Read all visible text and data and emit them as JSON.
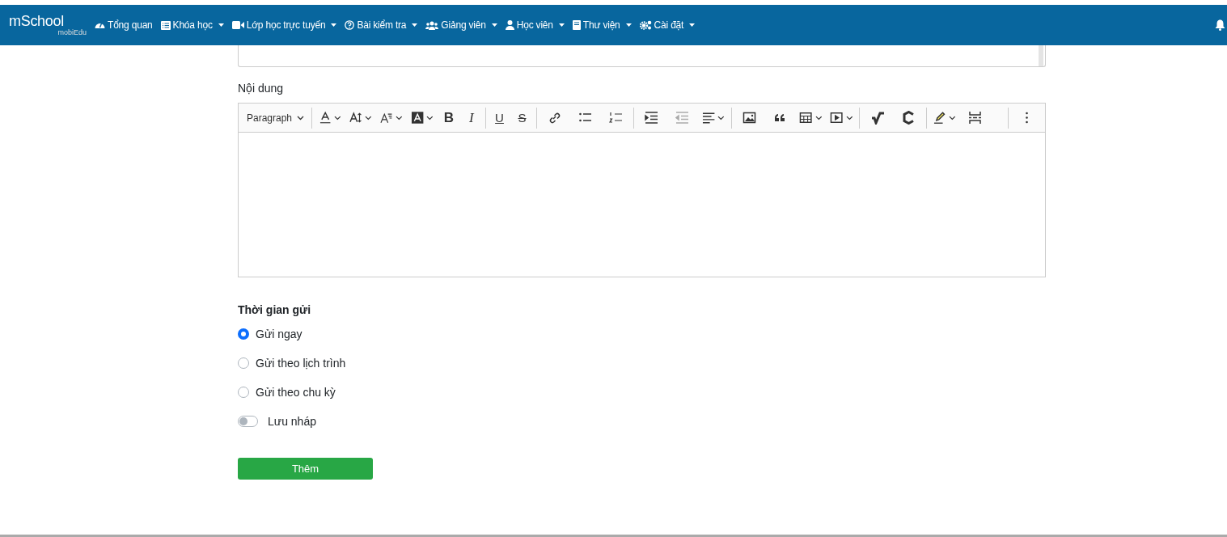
{
  "navbar": {
    "logo": {
      "name": "mSchool",
      "sub": "mobiEdu"
    },
    "items": [
      {
        "label": "Tổng quan",
        "dropdown": false
      },
      {
        "label": "Khóa học",
        "dropdown": true
      },
      {
        "label": "Lớp học trực tuyến",
        "dropdown": true
      },
      {
        "label": "Bài kiểm tra",
        "dropdown": true
      },
      {
        "label": "Giảng viên",
        "dropdown": true
      },
      {
        "label": "Học viên",
        "dropdown": true
      },
      {
        "label": "Thư viện",
        "dropdown": true
      },
      {
        "label": "Cài đặt",
        "dropdown": true
      }
    ]
  },
  "content_label": "Nội dung",
  "toolbar": [
    {
      "kind": "select",
      "label": "Paragraph",
      "dropdown": true
    },
    {
      "kind": "sep"
    },
    {
      "kind": "font-color",
      "dropdown": true
    },
    {
      "kind": "font-size",
      "dropdown": true
    },
    {
      "kind": "font-family",
      "dropdown": true
    },
    {
      "kind": "font-bg",
      "dropdown": true
    },
    {
      "kind": "bold",
      "text": "B"
    },
    {
      "kind": "italic",
      "text": "I"
    },
    {
      "kind": "sep"
    },
    {
      "kind": "underline",
      "text": "U"
    },
    {
      "kind": "strike",
      "text": "S"
    },
    {
      "kind": "sep"
    },
    {
      "kind": "link"
    },
    {
      "kind": "bullets"
    },
    {
      "kind": "numbers"
    },
    {
      "kind": "sep"
    },
    {
      "kind": "indent"
    },
    {
      "kind": "outdent",
      "disabled": true
    },
    {
      "kind": "align",
      "dropdown": true
    },
    {
      "kind": "sep"
    },
    {
      "kind": "image"
    },
    {
      "kind": "quote"
    },
    {
      "kind": "table",
      "dropdown": true
    },
    {
      "kind": "media",
      "dropdown": true
    },
    {
      "kind": "sep"
    },
    {
      "kind": "math"
    },
    {
      "kind": "chem"
    },
    {
      "kind": "sep"
    },
    {
      "kind": "highlight",
      "dropdown": true
    },
    {
      "kind": "pagebreak"
    },
    {
      "kind": "spacer"
    },
    {
      "kind": "sep"
    },
    {
      "kind": "more"
    }
  ],
  "send_time": {
    "title": "Thời gian gửi",
    "options": [
      {
        "label": "Gửi ngay",
        "selected": true
      },
      {
        "label": "Gửi theo lịch trình",
        "selected": false
      },
      {
        "label": "Gửi theo chu kỳ",
        "selected": false
      }
    ]
  },
  "draft": {
    "label": "Lưu nháp",
    "on": false
  },
  "submit": "Thêm"
}
